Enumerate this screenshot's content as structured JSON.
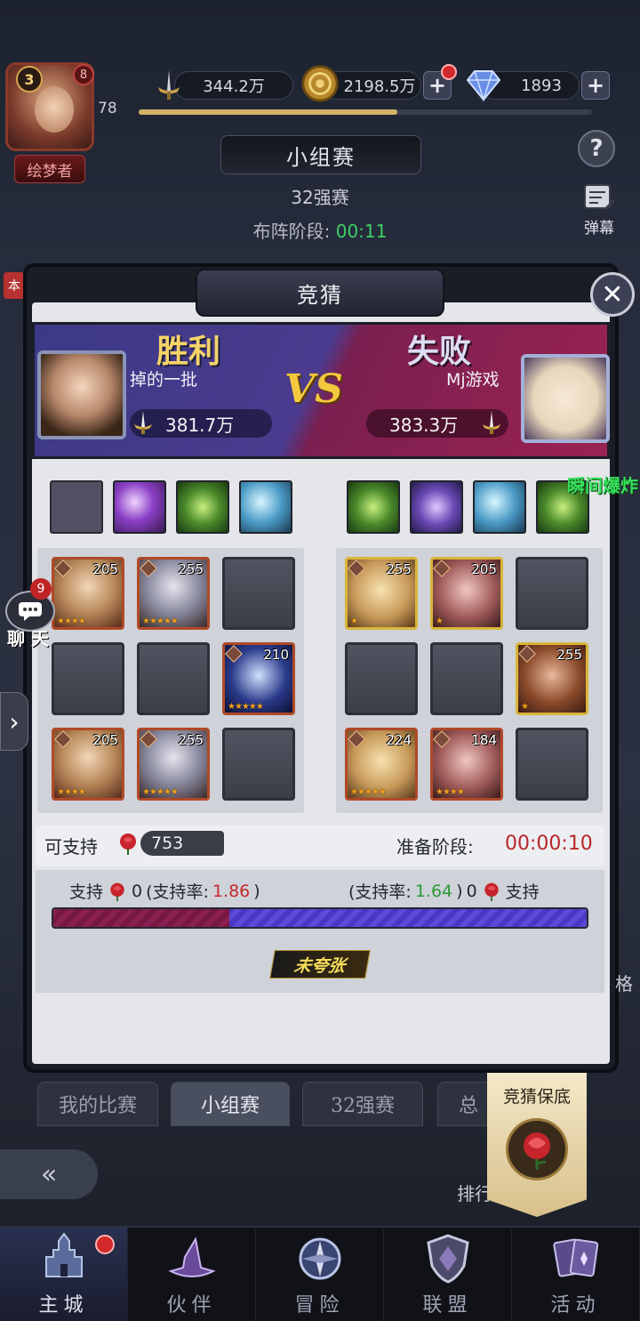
{
  "header": {
    "avatar_level": "3",
    "avatar_badge": "8",
    "player_level": "78",
    "title_tag": "绘梦者",
    "resources": {
      "power": "344.2万",
      "gold": "2198.5万",
      "gems": "1893"
    },
    "xp_fraction": 0.57,
    "help_label": "?",
    "danmu_label": "弹幕"
  },
  "stage": {
    "title": "小组赛",
    "round": "32强赛",
    "deploy_label": "布阵阶段:",
    "deploy_time": "00:11"
  },
  "side": {
    "ben_tag": "本",
    "chat_badge": "9",
    "chat_label": "聊 天",
    "edge_text": "格"
  },
  "modal": {
    "title": "竞猜",
    "close_label": "✕",
    "win_label": "胜利",
    "lose_label": "失败",
    "vs_label": "VS",
    "left_player": {
      "name": "掉的一批",
      "power": "381.7万"
    },
    "right_player": {
      "name": "Mj游戏",
      "power": "383.3万"
    },
    "burst_text": "瞬间爆炸",
    "left_skills": [
      "empty",
      "purple",
      "green",
      "blue"
    ],
    "right_skills": [
      "green",
      "violet",
      "blue",
      "green"
    ],
    "left_heroes": [
      {
        "level": "205",
        "stars": "★★★★",
        "frame": "red"
      },
      {
        "level": "255",
        "stars": "★★★★★",
        "frame": "red"
      },
      {
        "level": "",
        "frame": "empty"
      },
      {
        "level": "",
        "frame": "empty"
      },
      {
        "level": "",
        "frame": "empty"
      },
      {
        "level": "210",
        "stars": "★★★★★",
        "frame": "red"
      },
      {
        "level": "205",
        "stars": "★★★★",
        "frame": "red"
      },
      {
        "level": "255",
        "stars": "★★★★★",
        "frame": "red"
      },
      {
        "level": "",
        "frame": "empty"
      }
    ],
    "right_heroes": [
      {
        "level": "255",
        "stars": "★",
        "frame": "gold"
      },
      {
        "level": "205",
        "stars": "★",
        "frame": "gold"
      },
      {
        "level": "",
        "frame": "empty"
      },
      {
        "level": "",
        "frame": "empty"
      },
      {
        "level": "",
        "frame": "empty"
      },
      {
        "level": "255",
        "stars": "★",
        "frame": "gold"
      },
      {
        "level": "224",
        "stars": "★★★★★",
        "frame": "red"
      },
      {
        "level": "184",
        "stars": "★★★★",
        "frame": "red"
      },
      {
        "level": "",
        "frame": "empty"
      }
    ],
    "can_support_label": "可支持",
    "can_support_count": "753",
    "prep_label": "准备阶段:",
    "prep_time": "00:00:10",
    "left_support": {
      "label": "支持",
      "count": "0",
      "rate_prefix": "(支持率:",
      "rate": "1.86",
      "rate_suffix": ")"
    },
    "right_support": {
      "rate_prefix": "(支持率:",
      "rate": "1.64",
      "rate_suffix": ")",
      "count": "0",
      "label": "支持"
    },
    "support_split": 0.33,
    "no_exag_label": "未夸张"
  },
  "tabs": [
    {
      "label": "我的比赛",
      "active": false
    },
    {
      "label": "小组赛",
      "active": true
    },
    {
      "label": "32强赛",
      "active": false
    },
    {
      "label": "总",
      "active": false
    }
  ],
  "bottom": {
    "rank_shop": "排行 商店",
    "guarantee_label": "竞猜保底"
  },
  "nav": [
    {
      "label": "主城",
      "icon": "castle-icon",
      "active": true,
      "badge": true
    },
    {
      "label": "伙伴",
      "icon": "hat-icon",
      "active": false
    },
    {
      "label": "冒险",
      "icon": "compass-icon",
      "active": false
    },
    {
      "label": "联盟",
      "icon": "shield-icon",
      "active": false
    },
    {
      "label": "活动",
      "icon": "cards-icon",
      "active": false
    }
  ],
  "colors": {
    "win_gold": "#f6d46a",
    "prep_red": "#b8272a",
    "rate_red": "#c5282a",
    "rate_green": "#2d9a3c",
    "deploy_green": "#3fcf63"
  }
}
